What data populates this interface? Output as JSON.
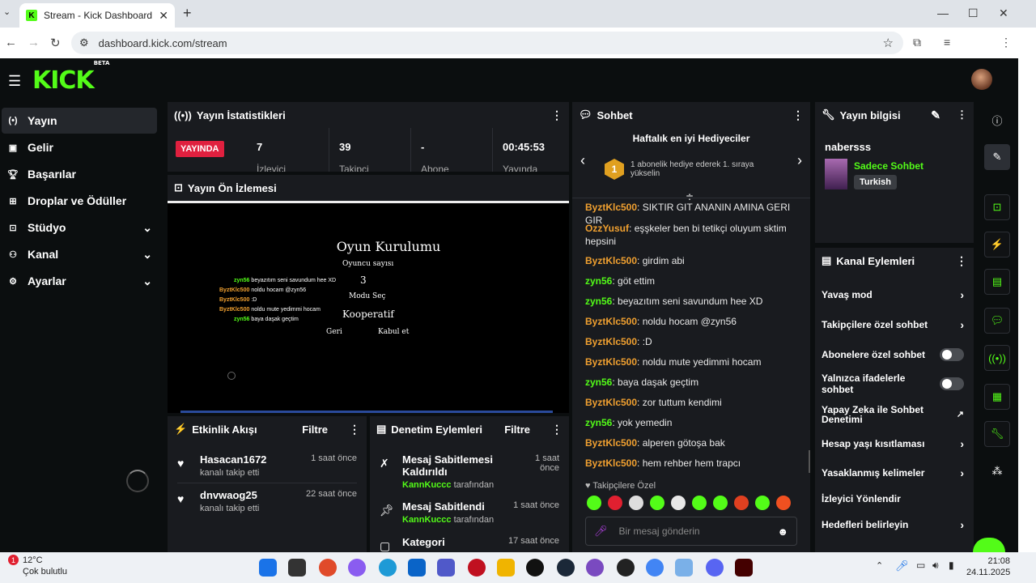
{
  "browser": {
    "tab_title": "Stream - Kick Dashboard",
    "url": "dashboard.kick.com/stream",
    "profile_initial": "K",
    "favicon": "K"
  },
  "brand": {
    "logo": "KICK",
    "beta": "BETA",
    "accent": "#53fc18"
  },
  "sidebar": {
    "items": [
      {
        "label": "Yayın",
        "icon": "broadcast-icon"
      },
      {
        "label": "Gelir",
        "icon": "revenue-icon"
      },
      {
        "label": "Başarılar",
        "icon": "trophy-icon"
      },
      {
        "label": "Droplar ve Ödüller",
        "icon": "gift-icon"
      },
      {
        "label": "Stüdyo",
        "icon": "studio-icon"
      },
      {
        "label": "Kanal",
        "icon": "channel-icon"
      },
      {
        "label": "Ayarlar",
        "icon": "gear-icon"
      }
    ]
  },
  "stats": {
    "title": "Yayın İstatistikleri",
    "live_badge": "YAYINDA",
    "items": [
      {
        "value": "7",
        "label": "İzleyici"
      },
      {
        "value": "39",
        "label": "Takipçi"
      },
      {
        "value": "-",
        "label": "Abone"
      },
      {
        "value": "00:45:53",
        "label": "Yayında"
      }
    ]
  },
  "preview": {
    "title": "Yayın Ön İzlemesi",
    "game_title": "Oyun Kurulumu",
    "player_count_label": "Oyuncu sayısı",
    "player_count": "3",
    "mode_label": "Modu Seç",
    "mode": "Kooperatif",
    "back": "Geri",
    "accept": "Kabul et",
    "overlay_chat": [
      {
        "user": "zyn56",
        "text": "beyazıtım seni savundum hee XD"
      },
      {
        "user": "ByztKlc500",
        "text": "noldu hocam @zyn56"
      },
      {
        "user": "ByztKlc500",
        "text": ":D"
      },
      {
        "user": "ByztKlc500",
        "text": "noldu mute yedimmi hocam"
      },
      {
        "user": "zyn56",
        "text": "baya daşak geçtim"
      }
    ]
  },
  "activity": {
    "title": "Etkinlik Akışı",
    "filter": "Filtre",
    "items": [
      {
        "name": "Hasacan1672",
        "desc": "kanalı takip etti",
        "time": "1 saat önce"
      },
      {
        "name": "dnvwaog25",
        "desc": "kanalı takip etti",
        "time": "22 saat önce"
      }
    ]
  },
  "moderation": {
    "title": "Denetim Eylemleri",
    "filter": "Filtre",
    "items": [
      {
        "title": "Mesaj Sabitlemesi Kaldırıldı",
        "by_user": "KannKuccc",
        "by_text": "tarafından",
        "time": "1 saat önce"
      },
      {
        "title": "Mesaj Sabitlendi",
        "by_user": "KannKuccc",
        "by_text": "tarafından",
        "time": "1 saat önce"
      },
      {
        "title": "Kategori",
        "time": "17 saat önce"
      }
    ]
  },
  "chat": {
    "title": "Sohbet",
    "top_gifters_title": "Haftalık en iyi Hediyeciler",
    "gifter_rank": "1",
    "gifter_text": "1 abonelik hediye ederek 1. sıraya yükselin",
    "messages": [
      {
        "user": "ByztKlc500",
        "text": "SIKTIR GIT ANANIN AMINA GERI GIR",
        "color": "#f0a030"
      },
      {
        "user": "OzzYusuf",
        "text": "eşşkeler ben bi tetikçi oluyum sktim hepsini",
        "color": "#f0a030"
      },
      {
        "user": "ByztKlc500",
        "text": "girdim abi",
        "color": "#f0a030"
      },
      {
        "user": "zyn56",
        "text": "göt ettim",
        "color": "#53fc18"
      },
      {
        "user": "zyn56",
        "text": "beyazıtım seni savundum hee XD",
        "color": "#53fc18"
      },
      {
        "user": "ByztKlc500",
        "text": "noldu hocam @zyn56",
        "color": "#f0a030"
      },
      {
        "user": "ByztKlc500",
        "text": ":D",
        "color": "#f0a030"
      },
      {
        "user": "ByztKlc500",
        "text": "noldu mute yedimmi hocam",
        "color": "#f0a030"
      },
      {
        "user": "zyn56",
        "text": "baya daşak geçtim",
        "color": "#53fc18"
      },
      {
        "user": "ByztKlc500",
        "text": "zor tuttum kendimi",
        "color": "#f0a030"
      },
      {
        "user": "zyn56",
        "text": "yok yemedin",
        "color": "#53fc18"
      },
      {
        "user": "ByztKlc500",
        "text": "alperen götoşa bak",
        "color": "#f0a030"
      },
      {
        "user": "ByztKlc500",
        "text": "hem rehber hem trapcı",
        "color": "#f0a030"
      }
    ],
    "followers_only": "Takipçilere Özel",
    "input_placeholder": "Bir mesaj gönderin"
  },
  "stream_info": {
    "title": "Yayın bilgisi",
    "stream_title": "nabersss",
    "category": "Sadece Sohbet",
    "language": "Turkish"
  },
  "channel_actions": {
    "title": "Kanal Eylemleri",
    "items": [
      {
        "label": "Yavaş mod",
        "control": "arrow"
      },
      {
        "label": "Takipçilere özel sohbet",
        "control": "arrow"
      },
      {
        "label": "Abonelere özel sohbet",
        "control": "toggle"
      },
      {
        "label": "Yalnızca ifadelerle sohbet",
        "control": "toggle"
      },
      {
        "label": "Yapay Zeka ile Sohbet Denetimi",
        "control": "external"
      },
      {
        "label": "Hesap yaşı kısıtlaması",
        "control": "arrow"
      },
      {
        "label": "Yasaklanmış kelimeler",
        "control": "arrow"
      },
      {
        "label": "İzleyici Yönlendir",
        "control": "none"
      },
      {
        "label": "Hedefleri belirleyin",
        "control": "arrow"
      }
    ]
  },
  "taskbar": {
    "weather_temp": "12°C",
    "weather_desc": "Çok bulutlu",
    "weather_badge": "1",
    "time": "21:08",
    "date": "24.11.2025"
  }
}
